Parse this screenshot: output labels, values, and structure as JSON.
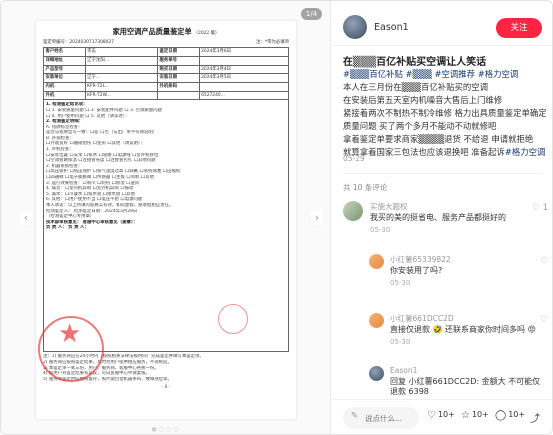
{
  "viewer": {
    "counter": "1/4"
  },
  "document": {
    "title": "家用空调产品质量鉴定单",
    "edition": "（2022 版）",
    "form_no_label": "鉴定单编号：",
    "form_no": "2024030717308027",
    "star_label": "注：*带为必填项",
    "rows": [
      [
        "客户姓名",
        "李志",
        "鉴定日期",
        "2024年3月6日"
      ],
      [
        "详细地址",
        "辽宁沈阳...",
        "服务单号",
        ""
      ],
      [
        "产品型号",
        "",
        "购买日期",
        "2024年3月4日"
      ],
      [
        "安装单位",
        "辽宁...",
        "安装日期",
        "2024年3月5日"
      ],
      [
        "内机",
        "KFR-72L...",
        "外机条码",
        ""
      ],
      [
        "外机",
        "KFR-72W...",
        "",
        "6527240..."
      ]
    ],
    "lines": [
      "1. 检测鉴定结论项：",
      "  口 1. 安装质量问题 口 2. 安装配件问题 口 3. 空调质量问题",
      "  口 4. 用户使用问题 口 5. 其他（请详述）：",
      "2. 检测鉴定明细：",
      "  A. 铭牌标签检查：",
      "  是否与铭牌型号一致：口是 口否（与出厂单不符请说明）",
      "  B. 外观检查：",
      "  口外观良好 口磕碰划伤 口变形 口其他（请说明）：",
      "  1. 外机检查：",
      "  口安装位置 口支架 口排水 口管路 口电源线 口室外机移位",
      "  口空调管路保温 口连接管长度 口连接管包扎 口其他问题",
      "  2. 机器系统检查：",
      "  口高压保护 口低压保护 口排气温度过高 口缺氟 口系统堵塞 口压缩机",
      "  口四通阀 口电子膨胀阀 口传感器 口主板 口风机 口其他",
      "  3. 运行效果检查：口制冷 口制热 口除湿 口送风",
      "  4. 噪音：口室内机异响 口室外机异响 口振动",
      "  5. 漏水：口冷凝水 口排水管 口接水盘 口其他",
      "  6. 其他：口用户使用不当 口电压不稳 口电源问题",
      "  本人承诺：以上所填内容真实有效，如有虚假，愿承担相应责任。",
      "  检测鉴定人：                     检测鉴定日期：2024年3月29日",
      "（检测鉴定中心专用章）",
      "技术部审核意见：                         客服中心审核意见（盖章）：",
      "负 责 人：                               负 责 人："
    ],
    "notes": [
      "注：1) 服务商应在24小时内（按照相关法律法规时间）完成鉴定并填写本鉴定单。",
      "    2) 服务商应按照鉴定结果，及时为用户提供相应服务，不得拖延。",
      "    3) 本鉴定单一式三份，用户、服务商、客服中心各执一份。",
      "    4) 如用户对鉴定结果有异议，可向客服中心申请复核。",
      "    5) 服务商鉴定时应拍照留存，照片需包含机器条码、故障部位等。"
    ],
    "page_no": "- 8 -"
  },
  "post": {
    "author": "Eason1",
    "follow_label": "关注",
    "title": "在▒▒▒百亿补贴买空调让人笑话",
    "body_lines": [
      "#▒▒▒百亿补贴 #▒▒▒ #空调推荐 #格力空调",
      "本人在三月份在▒▒▒百亿补贴买的空调",
      "在安装后第五天室内机噪音大售后上门维修",
      "紧接着两次不制热不制冷维修 格力出具质量鉴定单确定",
      "质量问题 买了两个多月不能动不动就修吧",
      "拿着鉴定单要求商家▒▒▒▒退货 不给退 申请就拒绝",
      "就算拿着国家三包法也应该退换吧 准备起诉#格力空调"
    ],
    "date": "05-29",
    "comment_count": "共 10 条评论"
  },
  "comments": [
    {
      "name": "实施大题权",
      "text": "我买的美的挺省电、服务产品都挺好的",
      "date": "05-30",
      "likes": "1"
    },
    {
      "name": "小红薯65339822",
      "text": "你安装用了吗?",
      "date": "05-30",
      "likes": ""
    },
    {
      "name": "小红薯661DCC2D",
      "text": "直接仅退款 🤣 还联系商家你时间多吗 😡",
      "date": "05-30",
      "likes": ""
    },
    {
      "name": "Eason1",
      "text": "回复 小红薯661DCC2D: 金额大 不可能仅退款 6398",
      "date": "",
      "likes": ""
    }
  ],
  "bottom_bar": {
    "comment_placeholder": "说点什么...",
    "likes": "10+",
    "stars": "10+",
    "comments": "10+"
  }
}
